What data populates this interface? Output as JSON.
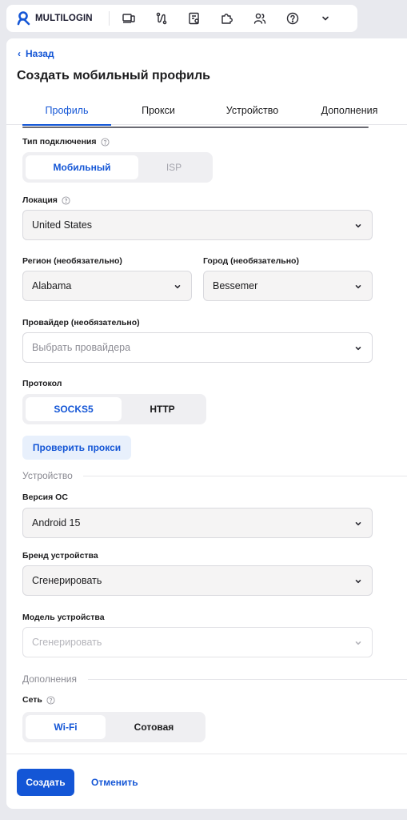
{
  "app": {
    "brand": "MULTILOGIN"
  },
  "toolbar": {
    "icons": [
      "devices-icon",
      "automation-icon",
      "profile-settings-icon",
      "extensions-icon",
      "team-icon",
      "help-icon",
      "chevron-down-icon"
    ]
  },
  "nav": {
    "back_label": "Назад"
  },
  "page": {
    "title": "Создать мобильный профиль"
  },
  "tabs": [
    {
      "label": "Профиль",
      "active": true
    },
    {
      "label": "Прокси",
      "active": false
    },
    {
      "label": "Устройство",
      "active": false
    },
    {
      "label": "Дополнения",
      "active": false
    }
  ],
  "connection": {
    "label": "Тип подключения",
    "options": [
      "Мобильный",
      "ISP"
    ],
    "selected": "Мобильный"
  },
  "location": {
    "label": "Локация",
    "value": "United States"
  },
  "region": {
    "label": "Регион (необязательно)",
    "value": "Alabama"
  },
  "city": {
    "label": "Город (необязательно)",
    "value": "Bessemer"
  },
  "provider": {
    "label": "Провайдер (необязательно)",
    "placeholder": "Выбрать провайдера"
  },
  "protocol": {
    "label": "Протокол",
    "options": [
      "SOCKS5",
      "HTTP"
    ],
    "selected": "SOCKS5"
  },
  "check_proxy_label": "Проверить прокси",
  "device_section": {
    "title": "Устройство",
    "os_label": "Версия ОС",
    "os_value": "Android 15",
    "brand_label": "Бренд устройства",
    "brand_value": "Сгенерировать",
    "model_label": "Модель устройства",
    "model_placeholder": "Сгенерировать"
  },
  "extras_section": {
    "title": "Дополнения",
    "network_label": "Сеть",
    "network_options": [
      "Wi-Fi",
      "Сотовая"
    ],
    "network_selected": "Wi-Fi"
  },
  "footer": {
    "create_label": "Создать",
    "cancel_label": "Отменить"
  },
  "colors": {
    "accent": "#1456d6",
    "accent_light": "#e8f0fc",
    "page_bg": "#e8e9ee"
  }
}
